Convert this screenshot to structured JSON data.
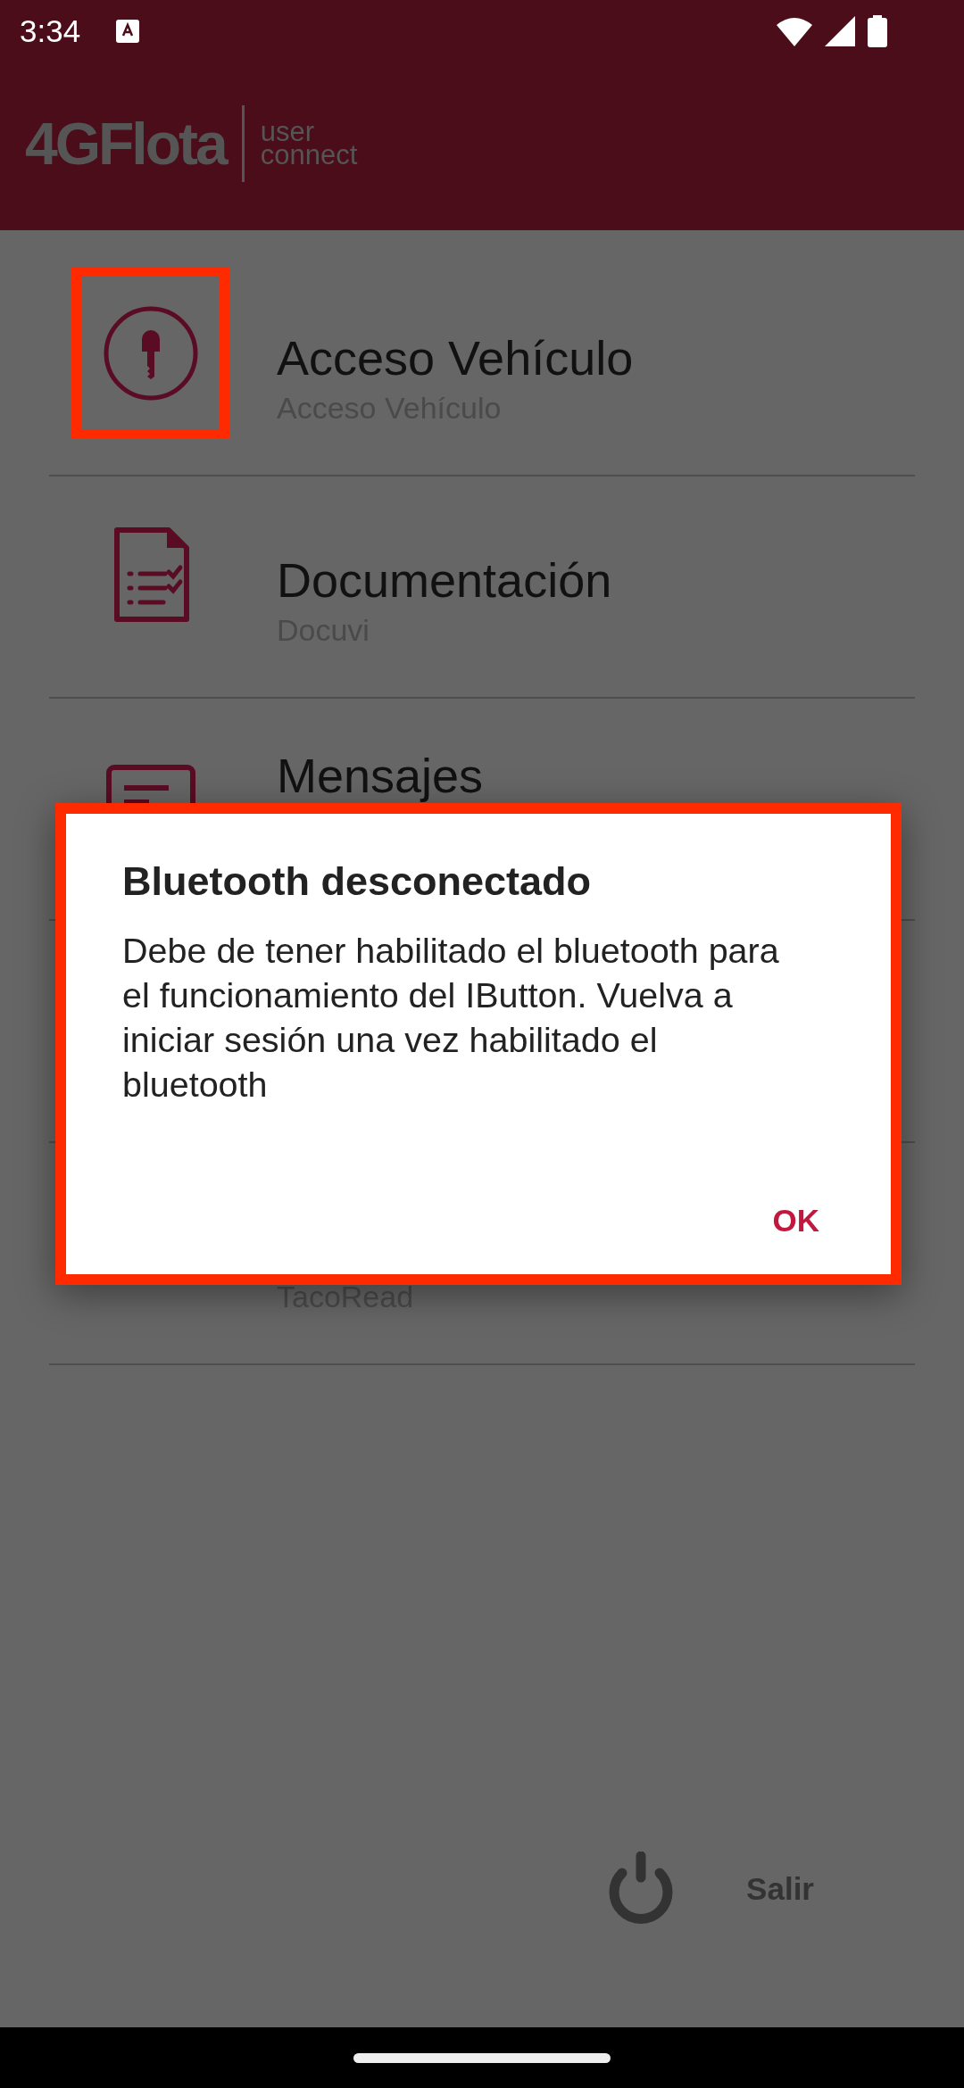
{
  "status_bar": {
    "time": "3:34"
  },
  "app_bar": {
    "logo": "4GFlota",
    "logo_sub_1": "user",
    "logo_sub_2": "connect"
  },
  "menu_items": [
    {
      "kind": "key",
      "title": "Acceso Vehículo",
      "subtitle": "Acceso Vehículo",
      "highlighted": true
    },
    {
      "kind": "document",
      "title": "Documentación",
      "subtitle": "Docuvi",
      "highlighted": false
    },
    {
      "kind": "message",
      "title": "Mensajes",
      "highlighted": false
    },
    {
      "kind": "hidden",
      "highlighted": false
    },
    {
      "kind": "hidden",
      "subtitle": "TacoRead",
      "highlighted": false
    }
  ],
  "exit": {
    "label": "Salir"
  },
  "dialog": {
    "title": "Bluetooth desconectado",
    "message": "Debe de tener habilitado el bluetooth para el funcionamiento del IButton. Vuelva a iniciar sesión una vez habilitado el bluetooth",
    "button": "OK",
    "highlighted": true
  }
}
